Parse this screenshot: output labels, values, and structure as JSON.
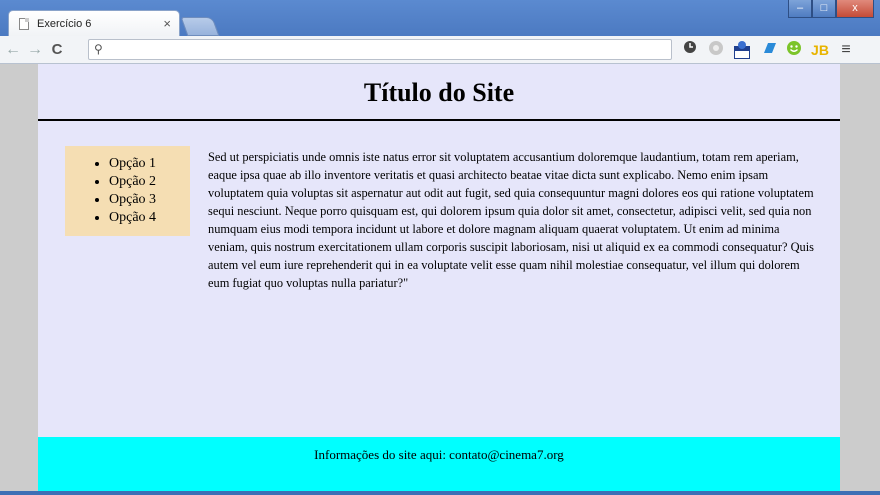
{
  "browser": {
    "tab_title": "Exercício 6",
    "tab_close": "×",
    "window_buttons": {
      "minimize": "–",
      "maximize": "□",
      "close": "x"
    },
    "nav": {
      "back": "←",
      "forward": "→",
      "reload": "C"
    },
    "omnibox_value": "",
    "menu_icon": "≡",
    "extensions": [
      "clock-icon",
      "disc-icon",
      "calendar-icon",
      "book-icon",
      "smiley-icon",
      "jb-icon"
    ],
    "ext_jb_label": "JB"
  },
  "site": {
    "title": "Título do Site",
    "menu_items": [
      "Opção 1",
      "Opção 2",
      "Opção 3",
      "Opção 4"
    ],
    "body_text": "Sed ut perspiciatis unde omnis iste natus error sit voluptatem accusantium doloremque laudantium, totam rem aperiam, eaque ipsa quae ab illo inventore veritatis et quasi architecto beatae vitae dicta sunt explicabo. Nemo enim ipsam voluptatem quia voluptas sit aspernatur aut odit aut fugit, sed quia consequuntur magni dolores eos qui ratione voluptatem sequi nesciunt. Neque porro quisquam est, qui dolorem ipsum quia dolor sit amet, consectetur, adipisci velit, sed quia non numquam eius modi tempora incidunt ut labore et dolore magnam aliquam quaerat voluptatem. Ut enim ad minima veniam, quis nostrum exercitationem ullam corporis suscipit laboriosam, nisi ut aliquid ex ea commodi consequatur? Quis autem vel eum iure reprehenderit qui in ea voluptate velit esse quam nihil molestiae consequatur, vel illum qui dolorem eum fugiat quo voluptas nulla pariatur?\"",
    "footer_text": "Informações do site aqui: contato@cinema7.org"
  },
  "colors": {
    "page_background": "#e6e6fa",
    "menu_background": "#f5deb3",
    "footer_background": "#00ffff",
    "window_frame": "#4a78c0"
  }
}
